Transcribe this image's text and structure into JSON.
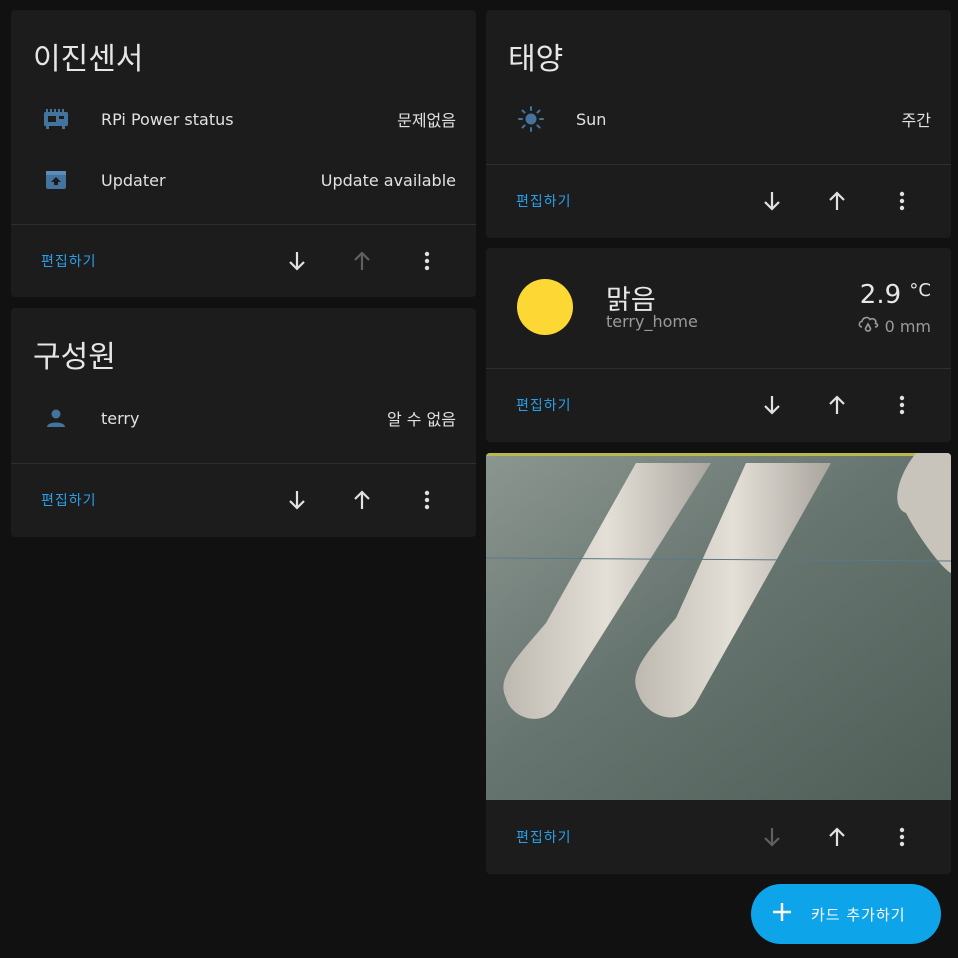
{
  "cards": {
    "binary_sensor": {
      "title": "이진센서",
      "rows": [
        {
          "icon": "raspberry-pi-icon",
          "name": "RPi Power status",
          "state": "문제없음"
        },
        {
          "icon": "package-up-icon",
          "name": "Updater",
          "state": "Update available"
        }
      ],
      "edit_label": "편집하기"
    },
    "person": {
      "title": "구성원",
      "rows": [
        {
          "icon": "person-icon",
          "name": "terry",
          "state": "알 수 없음"
        }
      ],
      "edit_label": "편집하기"
    },
    "sun": {
      "title": "태양",
      "rows": [
        {
          "icon": "sun-icon",
          "name": "Sun",
          "state": "주간"
        }
      ],
      "edit_label": "편집하기"
    },
    "weather": {
      "state": "맑음",
      "name": "terry_home",
      "temperature": "2.9",
      "unit": "°C",
      "precipitation": "0 mm",
      "edit_label": "편집하기"
    },
    "camera": {
      "edit_label": "편집하기"
    }
  },
  "fab": {
    "label": "카드 추가하기"
  },
  "colors": {
    "accent": "#2a9fe8",
    "fab": "#0ea4ea",
    "sun_yellow": "#fdd835",
    "icon_blue": "#44739e",
    "card_bg": "#1c1c1c",
    "page_bg": "#111111"
  }
}
